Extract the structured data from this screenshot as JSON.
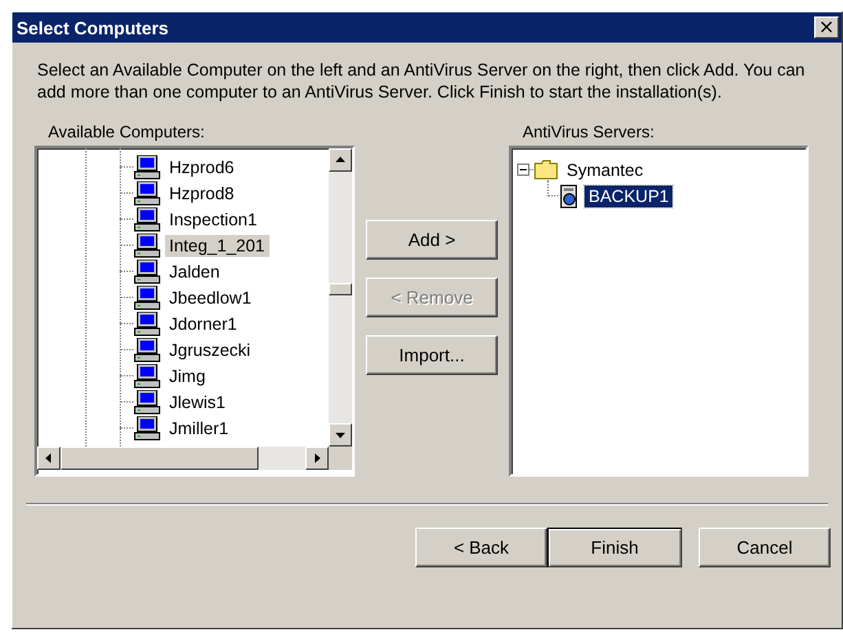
{
  "window": {
    "title": "Select Computers",
    "close": "×"
  },
  "instructions": "Select an Available Computer on the left and an AntiVirus Server on the right, then click Add. You can add more than one computer to an AntiVirus Server.  Click Finish to start the installation(s).",
  "computers": {
    "label": "Available Computers:",
    "items": [
      {
        "label": "Hzprod6",
        "selected": false
      },
      {
        "label": "Hzprod8",
        "selected": false
      },
      {
        "label": "Inspection1",
        "selected": false
      },
      {
        "label": "Integ_1_201",
        "selected": true
      },
      {
        "label": "Jalden",
        "selected": false
      },
      {
        "label": "Jbeedlow1",
        "selected": false
      },
      {
        "label": "Jdorner1",
        "selected": false
      },
      {
        "label": "Jgruszecki",
        "selected": false
      },
      {
        "label": "Jimg",
        "selected": false
      },
      {
        "label": "Jlewis1",
        "selected": false
      },
      {
        "label": "Jmiller1",
        "selected": false
      }
    ]
  },
  "actions": [
    {
      "label": "Add >",
      "disabled": false
    },
    {
      "label": "< Remove",
      "disabled": true
    },
    {
      "label": "Import...",
      "disabled": false
    }
  ],
  "servers": {
    "label": "AntiVirus Servers:",
    "items": [
      {
        "label": "Symantec",
        "expanded": true,
        "selected": false,
        "children": [
          {
            "label": "BACKUP1",
            "selected": true
          }
        ]
      }
    ]
  },
  "buttons": [
    {
      "label": "< Back",
      "default": false
    },
    {
      "label": "Finish",
      "default": true
    },
    {
      "label": "Cancel",
      "default": false
    }
  ]
}
